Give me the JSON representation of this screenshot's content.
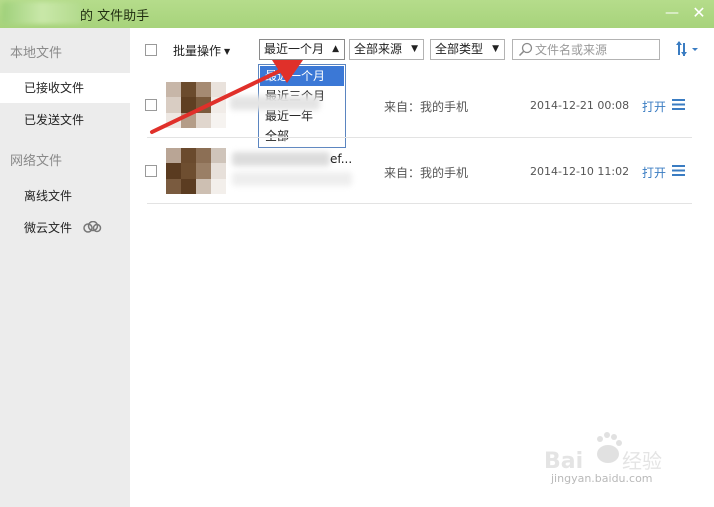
{
  "window": {
    "title": "的 文件助手",
    "minimize": "—",
    "close": "✕"
  },
  "sidebar": {
    "group_local": "本地文件",
    "items_local": [
      {
        "label": "已接收文件",
        "active": true
      },
      {
        "label": "已发送文件",
        "active": false
      }
    ],
    "group_network": "网络文件",
    "items_network": [
      {
        "label": "离线文件"
      },
      {
        "label": "微云文件",
        "icon": "cloud-icon"
      }
    ]
  },
  "toolbar": {
    "batch_label": "批量操作",
    "time_filter": "最近一个月",
    "source_filter": "全部来源",
    "type_filter": "全部类型",
    "search_placeholder": "文件名或来源",
    "sort_icon": "sort-icon"
  },
  "time_dropdown": {
    "options": [
      "最近一个月",
      "最近三个月",
      "最近一年",
      "全部"
    ],
    "selected": "最近一个月"
  },
  "files": [
    {
      "name_visible": "",
      "from": "来自：我的手机",
      "date": "2014-12-21 00:08",
      "action": "打开"
    },
    {
      "name_visible": "ef...",
      "from": "来自：我的手机",
      "date": "2014-12-10 11:02",
      "action": "打开"
    }
  ],
  "watermark": {
    "text": "jingyan.baidu.com"
  },
  "colors": {
    "titlebar": "#a9d47e",
    "sidebar": "#ececec",
    "selection": "#3b78d6",
    "link": "#3a7cc2",
    "annotation": "#e0302a"
  }
}
